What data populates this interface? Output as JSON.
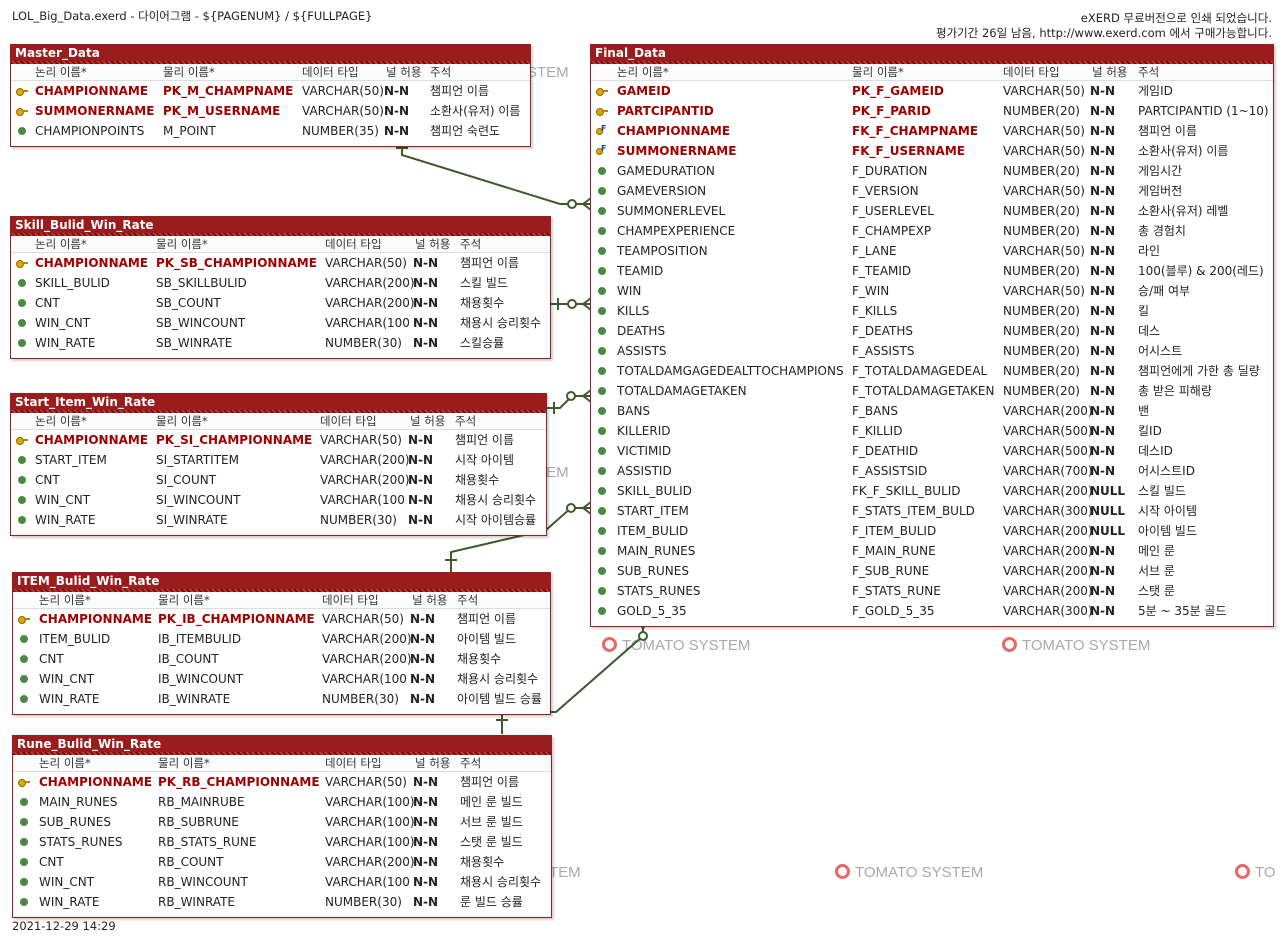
{
  "header": {
    "doc_title": "LOL_Big_Data.exerd - 다이어그램 - ${PAGENUM} / ${FULLPAGE}",
    "notice_line1": "eXERD 무료버전으로 인쇄 되었습니다.",
    "notice_line2": "평가기간 26일 남음, http://www.exerd.com 에서 구매가능합니다."
  },
  "footer": {
    "timestamp": "2021-12-29 14:29"
  },
  "watermark": {
    "text": "TOMATO SYSTEM",
    "partial_text": "STEM",
    "partial_text2": "TEM",
    "partial_text3": "TO"
  },
  "column_headers": {
    "logical": "논리 이름*",
    "physical": "물리 이름*",
    "datatype": "데이터 타입",
    "nullable": "널 허용",
    "comment": "주석"
  },
  "colors": {
    "table_border": "#9a1c1c",
    "key_text": "#a10000",
    "relation_line": "#3d5a2a"
  },
  "tables": [
    {
      "title": "Master_Data",
      "rows": [
        {
          "kind": "pk",
          "logical": "CHAMPIONNAME",
          "physical": "PK_M_CHAMPNAME",
          "type": "VARCHAR(50)",
          "null": "N-N",
          "comment": "챔피언 이름"
        },
        {
          "kind": "pk",
          "logical": "SUMMONERNAME",
          "physical": "PK_M_USERNAME",
          "type": "VARCHAR(50)",
          "null": "N-N",
          "comment": "소환사(유저) 이름"
        },
        {
          "kind": "col",
          "logical": "CHAMPIONPOINTS",
          "physical": "M_POINT",
          "type": "NUMBER(35)",
          "null": "N-N",
          "comment": "챔피언 숙련도"
        }
      ]
    },
    {
      "title": "Skill_Bulid_Win_Rate",
      "rows": [
        {
          "kind": "pk",
          "logical": "CHAMPIONNAME",
          "physical": "PK_SB_CHAMPIONNAME",
          "type": "VARCHAR(50)",
          "null": "N-N",
          "comment": "챔피언 이름"
        },
        {
          "kind": "col",
          "logical": "SKILL_BULID",
          "physical": "SB_SKILLBULID",
          "type": "VARCHAR(200)",
          "null": "N-N",
          "comment": "스킬 빌드"
        },
        {
          "kind": "col",
          "logical": "CNT",
          "physical": "SB_COUNT",
          "type": "VARCHAR(200)",
          "null": "N-N",
          "comment": "채용횟수"
        },
        {
          "kind": "col",
          "logical": "WIN_CNT",
          "physical": "SB_WINCOUNT",
          "type": "VARCHAR(100",
          "null": "N-N",
          "comment": "채용시 승리횟수"
        },
        {
          "kind": "col",
          "logical": "WIN_RATE",
          "physical": "SB_WINRATE",
          "type": "NUMBER(30)",
          "null": "N-N",
          "comment": "스킬승률"
        }
      ]
    },
    {
      "title": "Start_Item_Win_Rate",
      "rows": [
        {
          "kind": "pk",
          "logical": "CHAMPIONNAME",
          "physical": "PK_SI_CHAMPIONNAME",
          "type": "VARCHAR(50)",
          "null": "N-N",
          "comment": "챔피언 이름"
        },
        {
          "kind": "col",
          "logical": "START_ITEM",
          "physical": "SI_STARTITEM",
          "type": "VARCHAR(200)",
          "null": "N-N",
          "comment": "시작 아이템"
        },
        {
          "kind": "col",
          "logical": "CNT",
          "physical": "SI_COUNT",
          "type": "VARCHAR(200)",
          "null": "N-N",
          "comment": "채용횟수"
        },
        {
          "kind": "col",
          "logical": "WIN_CNT",
          "physical": "SI_WINCOUNT",
          "type": "VARCHAR(100",
          "null": "N-N",
          "comment": "채용시 승리횟수"
        },
        {
          "kind": "col",
          "logical": "WIN_RATE",
          "physical": "SI_WINRATE",
          "type": "NUMBER(30)",
          "null": "N-N",
          "comment": "시작 아이템승률"
        }
      ]
    },
    {
      "title": "ITEM_Bulid_Win_Rate",
      "rows": [
        {
          "kind": "pk",
          "logical": "CHAMPIONNAME",
          "physical": "PK_IB_CHAMPIONNAME",
          "type": "VARCHAR(50)",
          "null": "N-N",
          "comment": "챔피언 이름"
        },
        {
          "kind": "col",
          "logical": "ITEM_BULID",
          "physical": "IB_ITEMBULID",
          "type": "VARCHAR(200)",
          "null": "N-N",
          "comment": "아이템 빌드"
        },
        {
          "kind": "col",
          "logical": "CNT",
          "physical": "IB_COUNT",
          "type": "VARCHAR(200)",
          "null": "N-N",
          "comment": "채용횟수"
        },
        {
          "kind": "col",
          "logical": "WIN_CNT",
          "physical": "IB_WINCOUNT",
          "type": "VARCHAR(100",
          "null": "N-N",
          "comment": "채용시 승리횟수"
        },
        {
          "kind": "col",
          "logical": "WIN_RATE",
          "physical": "IB_WINRATE",
          "type": "NUMBER(30)",
          "null": "N-N",
          "comment": "아이템 빌드 승률"
        }
      ]
    },
    {
      "title": "Rune_Bulid_Win_Rate",
      "rows": [
        {
          "kind": "pk",
          "logical": "CHAMPIONNAME",
          "physical": "PK_RB_CHAMPIONNAME",
          "type": "VARCHAR(50)",
          "null": "N-N",
          "comment": "챔피언 이름"
        },
        {
          "kind": "col",
          "logical": "MAIN_RUNES",
          "physical": "RB_MAINRUBE",
          "type": "VARCHAR(100)",
          "null": "N-N",
          "comment": "메인 룬 빌드"
        },
        {
          "kind": "col",
          "logical": "SUB_RUNES",
          "physical": "RB_SUBRUNE",
          "type": "VARCHAR(100)",
          "null": "N-N",
          "comment": "서브 룬 빌드"
        },
        {
          "kind": "col",
          "logical": "STATS_RUNES",
          "physical": "RB_STATS_RUNE",
          "type": "VARCHAR(100)",
          "null": "N-N",
          "comment": "스탯 룬 빌드"
        },
        {
          "kind": "col",
          "logical": "CNT",
          "physical": "RB_COUNT",
          "type": "VARCHAR(200)",
          "null": "N-N",
          "comment": "채용횟수"
        },
        {
          "kind": "col",
          "logical": "WIN_CNT",
          "physical": "RB_WINCOUNT",
          "type": "VARCHAR(100",
          "null": "N-N",
          "comment": "채용시 승리횟수"
        },
        {
          "kind": "col",
          "logical": "WIN_RATE",
          "physical": "RB_WINRATE",
          "type": "NUMBER(30)",
          "null": "N-N",
          "comment": "룬 빌드 승률"
        }
      ]
    },
    {
      "title": "Final_Data",
      "rows": [
        {
          "kind": "pk",
          "logical": "GAMEID",
          "physical": "PK_F_GAMEID",
          "type": "VARCHAR(50)",
          "null": "N-N",
          "comment": "게임ID"
        },
        {
          "kind": "pk",
          "logical": "PARTCIPANTID",
          "physical": "PK_F_PARID",
          "type": "NUMBER(20)",
          "null": "N-N",
          "comment": "PARTCIPANTID (1~10)"
        },
        {
          "kind": "fk",
          "logical": "CHAMPIONNAME",
          "physical": "FK_F_CHAMPNAME",
          "type": "VARCHAR(50)",
          "null": "N-N",
          "comment": "챔피언 이름"
        },
        {
          "kind": "fk",
          "logical": "SUMMONERNAME",
          "physical": "FK_F_USERNAME",
          "type": "VARCHAR(50)",
          "null": "N-N",
          "comment": "소환사(유저) 이름"
        },
        {
          "kind": "col",
          "logical": "GAMEDURATION",
          "physical": "F_DURATION",
          "type": "NUMBER(20)",
          "null": "N-N",
          "comment": "게임시간"
        },
        {
          "kind": "col",
          "logical": "GAMEVERSION",
          "physical": "F_VERSION",
          "type": "VARCHAR(50)",
          "null": "N-N",
          "comment": "게임버전"
        },
        {
          "kind": "col",
          "logical": "SUMMONERLEVEL",
          "physical": "F_USERLEVEL",
          "type": "NUMBER(20)",
          "null": "N-N",
          "comment": "소환사(유저) 레벨"
        },
        {
          "kind": "col",
          "logical": "CHAMPEXPERIENCE",
          "physical": "F_CHAMPEXP",
          "type": "NUMBER(20)",
          "null": "N-N",
          "comment": "총 경험치"
        },
        {
          "kind": "col",
          "logical": "TEAMPOSITION",
          "physical": "F_LANE",
          "type": "VARCHAR(50)",
          "null": "N-N",
          "comment": "라인"
        },
        {
          "kind": "col",
          "logical": "TEAMID",
          "physical": "F_TEAMID",
          "type": "NUMBER(20)",
          "null": "N-N",
          "comment": "100(블루) & 200(레드)"
        },
        {
          "kind": "col",
          "logical": "WIN",
          "physical": "F_WIN",
          "type": "VARCHAR(50)",
          "null": "N-N",
          "comment": "승/패 여부"
        },
        {
          "kind": "col",
          "logical": "KILLS",
          "physical": "F_KILLS",
          "type": "NUMBER(20)",
          "null": "N-N",
          "comment": "킬"
        },
        {
          "kind": "col",
          "logical": "DEATHS",
          "physical": "F_DEATHS",
          "type": "NUMBER(20)",
          "null": "N-N",
          "comment": "데스"
        },
        {
          "kind": "col",
          "logical": "ASSISTS",
          "physical": "F_ASSISTS",
          "type": "NUMBER(20)",
          "null": "N-N",
          "comment": "어시스트"
        },
        {
          "kind": "col",
          "logical": "TOTALDAMGAGEDEALTTOCHAMPIONS",
          "physical": "F_TOTALDAMAGEDEAL",
          "type": "NUMBER(20)",
          "null": "N-N",
          "comment": "챔피언에게 가한 총 딜량"
        },
        {
          "kind": "col",
          "logical": "TOTALDAMAGETAKEN",
          "physical": "F_TOTALDAMAGETAKEN",
          "type": "NUMBER(20)",
          "null": "N-N",
          "comment": "총 받은 피해량"
        },
        {
          "kind": "col",
          "logical": "BANS",
          "physical": "F_BANS",
          "type": "VARCHAR(200)",
          "null": "N-N",
          "comment": "밴"
        },
        {
          "kind": "col",
          "logical": "KILLERID",
          "physical": "F_KILLID",
          "type": "VARCHAR(500)",
          "null": "N-N",
          "comment": "킬ID"
        },
        {
          "kind": "col",
          "logical": "VICTIMID",
          "physical": "F_DEATHID",
          "type": "VARCHAR(500)",
          "null": "N-N",
          "comment": "데스ID"
        },
        {
          "kind": "col",
          "logical": "ASSISTID",
          "physical": "F_ASSISTSID",
          "type": "VARCHAR(700)",
          "null": "N-N",
          "comment": "어시스트ID"
        },
        {
          "kind": "col",
          "logical": "SKILL_BULID",
          "physical": "FK_F_SKILL_BULID",
          "type": "VARCHAR(200)",
          "null": "NULL",
          "comment": "스킬 빌드"
        },
        {
          "kind": "col",
          "logical": "START_ITEM",
          "physical": "F_STATS_ITEM_BULD",
          "type": "VARCHAR(300)",
          "null": "NULL",
          "comment": "시작 아이템"
        },
        {
          "kind": "col",
          "logical": "ITEM_BULID",
          "physical": "F_ITEM_BULID",
          "type": "VARCHAR(200)",
          "null": "NULL",
          "comment": "아이템 빌드"
        },
        {
          "kind": "col",
          "logical": "MAIN_RUNES",
          "physical": "F_MAIN_RUNE",
          "type": "VARCHAR(200)",
          "null": "N-N",
          "comment": "메인 룬"
        },
        {
          "kind": "col",
          "logical": "SUB_RUNES",
          "physical": "F_SUB_RUNE",
          "type": "VARCHAR(200)",
          "null": "N-N",
          "comment": "서브 룬"
        },
        {
          "kind": "col",
          "logical": "STATS_RUNES",
          "physical": "F_STATS_RUNE",
          "type": "VARCHAR(200)",
          "null": "N-N",
          "comment": "스탯 룬"
        },
        {
          "kind": "col",
          "logical": "GOLD_5_35",
          "physical": "F_GOLD_5_35",
          "type": "VARCHAR(300)",
          "null": "N-N",
          "comment": "5분 ~ 35분 골드"
        }
      ]
    }
  ]
}
